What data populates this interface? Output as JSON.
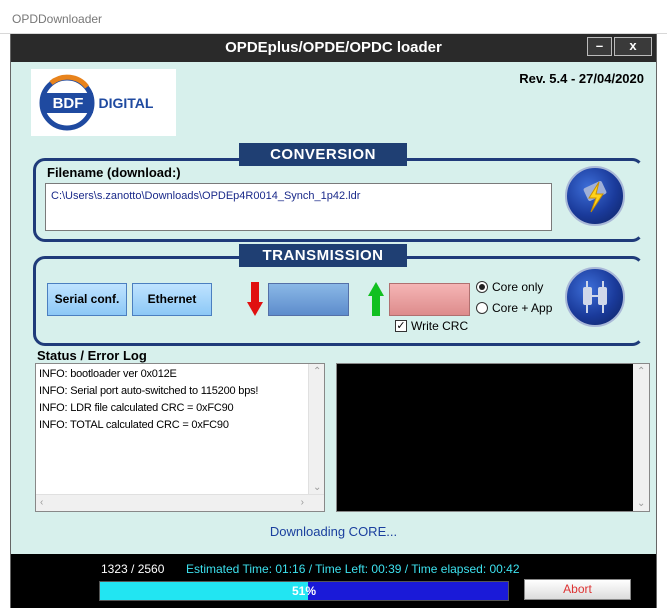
{
  "window": {
    "outer_title": "OPDDownloader",
    "title": "OPDEplus/OPDE/OPDC loader",
    "min_label": "–",
    "close_label": "x"
  },
  "logo": {
    "text_left": "BDF",
    "text_right": "DIGITAL"
  },
  "revision": "Rev. 5.4 - 27/04/2020",
  "conversion": {
    "header": "CONVERSION",
    "filename_label": "Filename (download:)",
    "filename_value": "C:\\Users\\s.zanotto\\Downloads\\OPDEp4R0014_Synch_1p42.ldr"
  },
  "transmission": {
    "header": "TRANSMISSION",
    "serial_conf_label": "Serial conf.",
    "ethernet_label": "Ethernet",
    "radio_core_only": "Core only",
    "radio_core_app": "Core + App",
    "selected_mode": "Core only",
    "write_crc_label": "Write CRC",
    "write_crc_checked": true
  },
  "status": {
    "label": "Status / Error Log",
    "lines": [
      "INFO: bootloader ver 0x012E",
      "INFO: Serial port auto-switched to 115200 bps!",
      "INFO: LDR file calculated CRC = 0xFC90",
      "INFO: TOTAL calculated CRC = 0xFC90"
    ]
  },
  "download_status": "Downloading CORE...",
  "progress": {
    "counts": "1323  /  2560",
    "times": "Estimated Time: 01:16 / Time Left: 00:39 / Time elapsed: 00:42",
    "percent_label": "51%",
    "fraction": 0.51,
    "abort_label": "Abort"
  },
  "colors": {
    "accent": "#1f3f73",
    "progress_fill": "#22e5f2",
    "progress_bg": "#1a1ad8"
  }
}
